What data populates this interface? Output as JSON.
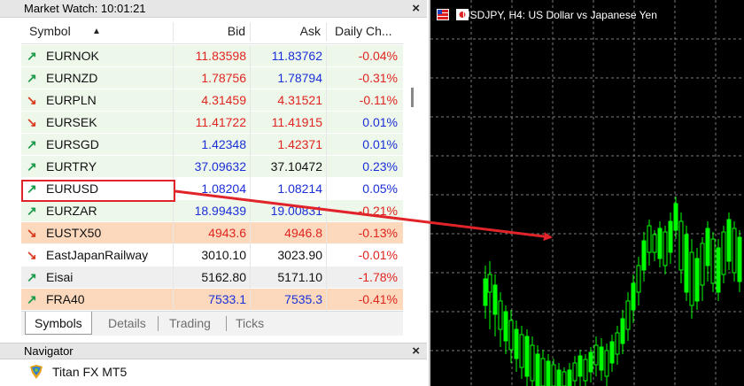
{
  "market_watch": {
    "title": "Market Watch: 10:01:21",
    "close": "×",
    "columns": {
      "symbol": "Symbol",
      "sort_glyph": "▲",
      "bid": "Bid",
      "ask": "Ask",
      "change": "Daily Ch..."
    },
    "rows": [
      {
        "symbol": "EURNOK",
        "dir": "up",
        "bid": "11.83598",
        "ask": "11.83762",
        "change": "-0.04%",
        "bg": "green",
        "bid_color": "red",
        "ask_color": "blue",
        "chg_color": "red"
      },
      {
        "symbol": "EURNZD",
        "dir": "up",
        "bid": "1.78756",
        "ask": "1.78794",
        "change": "-0.31%",
        "bg": "green",
        "bid_color": "red",
        "ask_color": "blue",
        "chg_color": "red"
      },
      {
        "symbol": "EURPLN",
        "dir": "down",
        "bid": "4.31459",
        "ask": "4.31521",
        "change": "-0.11%",
        "bg": "green",
        "bid_color": "red",
        "ask_color": "red",
        "chg_color": "red"
      },
      {
        "symbol": "EURSEK",
        "dir": "down",
        "bid": "11.41722",
        "ask": "11.41915",
        "change": "0.01%",
        "bg": "green",
        "bid_color": "red",
        "ask_color": "red",
        "chg_color": "blue"
      },
      {
        "symbol": "EURSGD",
        "dir": "up",
        "bid": "1.42348",
        "ask": "1.42371",
        "change": "0.01%",
        "bg": "green",
        "bid_color": "blue",
        "ask_color": "red",
        "chg_color": "blue"
      },
      {
        "symbol": "EURTRY",
        "dir": "up",
        "bid": "37.09632",
        "ask": "37.10472",
        "change": "0.23%",
        "bg": "green",
        "bid_color": "blue",
        "ask_color": "black",
        "chg_color": "blue"
      },
      {
        "symbol": "EURUSD",
        "dir": "up",
        "bid": "1.08204",
        "ask": "1.08214",
        "change": "0.05%",
        "bg": "white",
        "bid_color": "blue",
        "ask_color": "blue",
        "chg_color": "blue"
      },
      {
        "symbol": "EURZAR",
        "dir": "up",
        "bid": "18.99439",
        "ask": "19.00831",
        "change": "-0.21%",
        "bg": "green",
        "bid_color": "blue",
        "ask_color": "blue",
        "chg_color": "red"
      },
      {
        "symbol": "EUSTX50",
        "dir": "down",
        "bid": "4943.6",
        "ask": "4946.8",
        "change": "-0.13%",
        "bg": "orange",
        "bid_color": "red",
        "ask_color": "red",
        "chg_color": "red"
      },
      {
        "symbol": "EastJapanRailway",
        "dir": "down",
        "bid": "3010.10",
        "ask": "3023.90",
        "change": "-0.01%",
        "bg": "white",
        "bid_color": "black",
        "ask_color": "black",
        "chg_color": "red"
      },
      {
        "symbol": "Eisai",
        "dir": "up",
        "bid": "5162.80",
        "ask": "5171.10",
        "change": "-1.78%",
        "bg": "gray",
        "bid_color": "black",
        "ask_color": "black",
        "chg_color": "red"
      },
      {
        "symbol": "FRA40",
        "dir": "up",
        "bid": "7533.1",
        "ask": "7535.3",
        "change": "-0.41%",
        "bg": "orange",
        "bid_color": "blue",
        "ask_color": "blue",
        "chg_color": "red"
      }
    ],
    "tabs": [
      "Symbols",
      "Details",
      "Trading",
      "Ticks"
    ],
    "active_tab": "Symbols"
  },
  "navigator": {
    "title": "Navigator",
    "close": "×",
    "item": "Titan FX MT5"
  },
  "chart": {
    "title": "USDJPY, H4:  US Dollar vs Japanese Yen",
    "background": "#000000",
    "bull_color": "#00ff00",
    "grid_color": "#7a7a7a"
  },
  "colors": {
    "up": "#1a9a4a",
    "down": "#d83a1e",
    "price_blue": "#1a2fd8",
    "price_red": "#e0241f",
    "annotation": "#e0242a"
  },
  "arrow_glyphs": {
    "up": "↗",
    "down": "↘"
  }
}
